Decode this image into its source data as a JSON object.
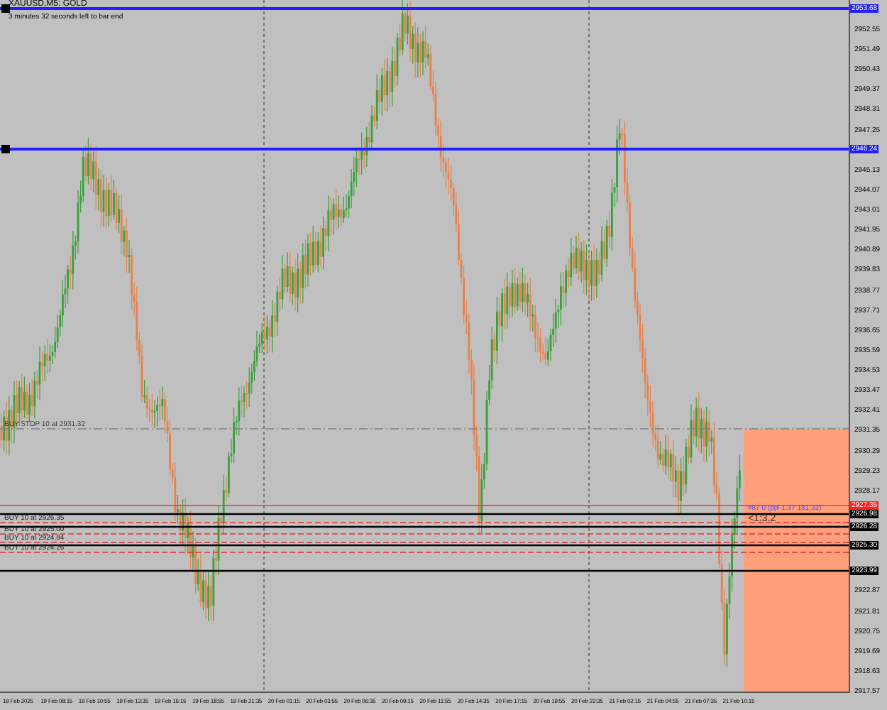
{
  "chart": {
    "title": "XAUUSD,M5: GOLD",
    "subtitle": "3 minutes 32 seconds left to bar end",
    "order_labels": [
      {
        "text": "BUY STOP 10 at 2931.32",
        "kind": "pending"
      },
      {
        "text": "BUY 10 at 2926.35",
        "kind": "open"
      },
      {
        "text": "BUY 10 at 2925.00",
        "kind": "open"
      },
      {
        "text": "BUY 10 at 2924.84",
        "kind": "open"
      },
      {
        "text": "BUY 10 at 2924.26",
        "kind": "open"
      }
    ],
    "position_label": "#87 0 (ppl 1.37 181.32)",
    "ratio_label": "<1:3.2",
    "price_axis": [
      "2952.55",
      "2951.49",
      "2950.43",
      "2949.37",
      "2948.31",
      "2947.25",
      "2945.13",
      "2944.07",
      "2943.01",
      "2941.95",
      "2940.89",
      "2939.83",
      "2938.77",
      "2937.71",
      "2936.65",
      "2935.59",
      "2934.53",
      "2933.47",
      "2932.41",
      "2931.35",
      "2930.29",
      "2929.23",
      "2928.17",
      "2922.87",
      "2921.81",
      "2920.75",
      "2919.69",
      "2918.63",
      "2917.57"
    ],
    "price_markers": [
      {
        "text": "2953.68",
        "kind": "alert"
      },
      {
        "text": "2946.24",
        "kind": "alert"
      },
      {
        "text": "2927.35",
        "kind": "current"
      },
      {
        "text": "2926.98",
        "kind": "level"
      },
      {
        "text": "2926.28",
        "kind": "level"
      },
      {
        "text": "2925.30",
        "kind": "level"
      },
      {
        "text": "2923.99",
        "kind": "level"
      }
    ],
    "time_axis": [
      "19 Feb 2025",
      "19 Feb 08:15",
      "19 Feb 10:55",
      "19 Feb 13:35",
      "19 Feb 16:15",
      "19 Feb 18:55",
      "19 Feb 21:35",
      "20 Feb 01:15",
      "20 Feb 03:55",
      "20 Feb 06:35",
      "20 Feb 09:15",
      "20 Feb 11:55",
      "20 Feb 14:35",
      "20 Feb 17:15",
      "20 Feb 19:55",
      "20 Feb 22:35",
      "21 Feb 02:15",
      "21 Feb 04:55",
      "21 Feb 07:35",
      "21 Feb 10:15"
    ]
  }
}
